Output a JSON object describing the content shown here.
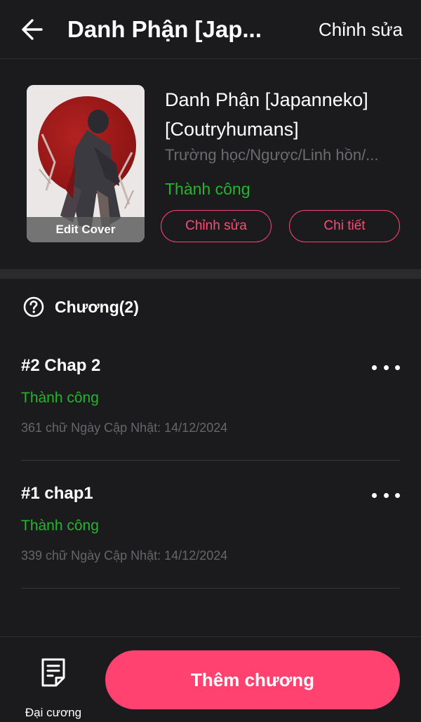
{
  "header": {
    "title": "Danh Phận [Jap...",
    "edit_label": "Chỉnh sửa"
  },
  "story": {
    "title": "Danh Phận [Japanneko] [Coutryhumans]",
    "tags": "Trường học/Ngược/Linh hồn/...",
    "status": "Thành công",
    "cover_label": "Edit Cover",
    "edit_button": "Chỉnh sửa",
    "detail_button": "Chi tiết"
  },
  "chapters": {
    "label": "Chương(2)",
    "items": [
      {
        "title": "#2 Chap 2",
        "status": "Thành công",
        "meta": "361 chữ Ngày Cập Nhật: 14/12/2024"
      },
      {
        "title": "#1 chap1",
        "status": "Thành công",
        "meta": "339 chữ Ngày Cập Nhật: 14/12/2024"
      }
    ]
  },
  "footer": {
    "outline_label": "Đại cương",
    "add_chapter": "Thêm chương"
  },
  "icons": {
    "back": "arrow-left-icon",
    "help": "question-circle-icon",
    "more": "more-horizontal-icon",
    "outline": "document-icon"
  },
  "colors": {
    "background": "#1b1b1d",
    "accent": "#ff4270",
    "success": "#1fb82b",
    "muted": "#6c6c70",
    "divider": "#2b2b2d"
  }
}
